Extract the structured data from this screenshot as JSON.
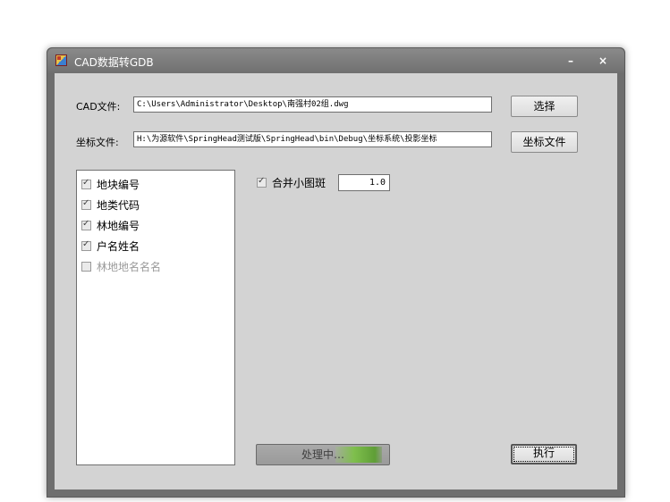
{
  "window": {
    "title": "CAD数据转GDB",
    "minimize_glyph": "–",
    "close_glyph": "×"
  },
  "cad_file": {
    "label": "CAD文件:",
    "value": "C:\\Users\\Administrator\\Desktop\\南强村02组.dwg",
    "button": "选择"
  },
  "coord_file": {
    "label": "坐标文件:",
    "value": "H:\\为源软件\\SpringHead测试版\\SpringHead\\bin\\Debug\\坐标系统\\投影坐标",
    "button": "坐标文件"
  },
  "fields": [
    {
      "label": "地块编号",
      "checked": true,
      "enabled": true
    },
    {
      "label": "地类代码",
      "checked": true,
      "enabled": true
    },
    {
      "label": "林地编号",
      "checked": true,
      "enabled": true
    },
    {
      "label": "户名姓名",
      "checked": true,
      "enabled": true
    },
    {
      "label": "林地地名名名",
      "checked": false,
      "enabled": false
    }
  ],
  "merge": {
    "label": "合并小图斑",
    "checked": true,
    "value": "1.0"
  },
  "progress": {
    "text": "处理中…"
  },
  "execute_button": "执行"
}
